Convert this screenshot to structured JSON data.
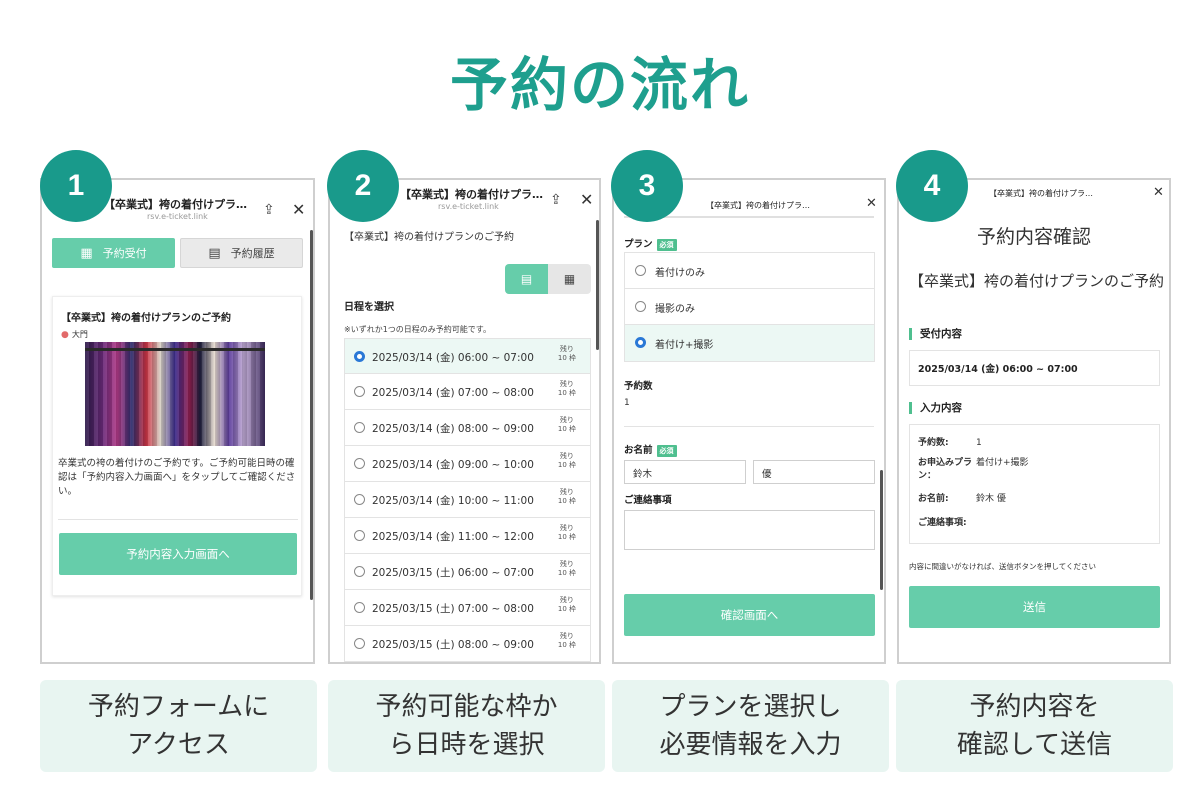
{
  "title": "予約の流れ",
  "colors": {
    "accent": "#199a8b",
    "button": "#66cdaa",
    "caption_bg": "#e8f5f1"
  },
  "steps": [
    {
      "number": "1",
      "caption_lines": [
        "予約フォームに",
        "アクセス"
      ]
    },
    {
      "number": "2",
      "caption_lines": [
        "予約可能な枠か",
        "ら日時を選択"
      ]
    },
    {
      "number": "3",
      "caption_lines": [
        "プランを選択し",
        "必要情報を入力"
      ]
    },
    {
      "number": "4",
      "caption_lines": [
        "予約内容を",
        "確認して送信"
      ]
    }
  ],
  "screen1": {
    "header_title": "【卒業式】袴の着付けプラ…",
    "header_url": "rsv.e-ticket.link",
    "share_icon": "share-icon",
    "close_icon": "close-icon",
    "tab_reserve": "予約受付",
    "tab_history": "予約履歴",
    "card_title": "【卒業式】袴の着付けプランのご予約",
    "location": "大門",
    "description": "卒業式の袴の着付けのご予約です。ご予約可能日時の確認は「予約内容入力画面へ」をタップしてご確認ください。",
    "cta": "予約内容入力画面へ"
  },
  "screen2": {
    "header_title": "【卒業式】袴の着付けプラ…",
    "header_url": "rsv.e-ticket.link",
    "plan_title": "【卒業式】袴の着付けプランのご予約",
    "select_label": "日程を選択",
    "note": "※いずれか1つの日程のみ予約可能です。",
    "remain_label": "残り",
    "slots": [
      {
        "time": "2025/03/14 (金) 06:00 ~ 07:00",
        "remain": "10 枠",
        "selected": true
      },
      {
        "time": "2025/03/14 (金) 07:00 ~ 08:00",
        "remain": "10 枠",
        "selected": false
      },
      {
        "time": "2025/03/14 (金) 08:00 ~ 09:00",
        "remain": "10 枠",
        "selected": false
      },
      {
        "time": "2025/03/14 (金) 09:00 ~ 10:00",
        "remain": "10 枠",
        "selected": false
      },
      {
        "time": "2025/03/14 (金) 10:00 ~ 11:00",
        "remain": "10 枠",
        "selected": false
      },
      {
        "time": "2025/03/14 (金) 11:00 ~ 12:00",
        "remain": "10 枠",
        "selected": false
      },
      {
        "time": "2025/03/15 (土) 06:00 ~ 07:00",
        "remain": "10 枠",
        "selected": false
      },
      {
        "time": "2025/03/15 (土) 07:00 ~ 08:00",
        "remain": "10 枠",
        "selected": false
      },
      {
        "time": "2025/03/15 (土) 08:00 ~ 09:00",
        "remain": "10 枠",
        "selected": false
      }
    ]
  },
  "screen3": {
    "header_title": "【卒業式】袴の着付けプラ…",
    "plan_label": "プラン",
    "required": "必須",
    "options": [
      {
        "label": "着付けのみ",
        "selected": false
      },
      {
        "label": "撮影のみ",
        "selected": false
      },
      {
        "label": "着付け+撮影",
        "selected": true
      }
    ],
    "count_label": "予約数",
    "count_value": "1",
    "name_label": "お名前",
    "last_name": "鈴木",
    "first_name": "優",
    "memo_label": "ご連絡事項",
    "cta": "確認画面へ"
  },
  "screen4": {
    "header_title": "【卒業式】袴の着付けプラ…",
    "confirm_title": "予約内容確認",
    "plan_name": "【卒業式】袴の着付けプランのご予約",
    "section_reception": "受付内容",
    "reception_value": "2025/03/14 (金) 06:00 ~ 07:00",
    "section_input": "入力内容",
    "rows": [
      {
        "key": "予約数:",
        "value": "1"
      },
      {
        "key": "お申込みプラン：",
        "value": "着付け+撮影"
      },
      {
        "key": "お名前:",
        "value": "鈴木 優"
      },
      {
        "key": "ご連絡事項:",
        "value": ""
      }
    ],
    "notice": "内容に間違いがなければ、送信ボタンを押してください",
    "cta": "送信"
  }
}
